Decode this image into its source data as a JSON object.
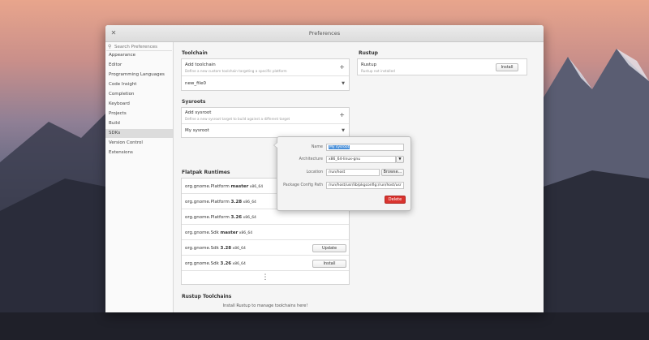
{
  "window": {
    "title": "Preferences"
  },
  "sidebar": {
    "search_placeholder": "Search Preferences",
    "items": [
      {
        "label": "Appearance"
      },
      {
        "label": "Editor"
      },
      {
        "label": "Programming Languages"
      },
      {
        "label": "Code Insight"
      },
      {
        "label": "Completion"
      },
      {
        "label": "Keyboard"
      },
      {
        "label": "Projects"
      },
      {
        "label": "Build"
      },
      {
        "label": "SDKs",
        "active": true
      },
      {
        "label": "Version Control"
      },
      {
        "label": "Extensions"
      }
    ]
  },
  "toolchain": {
    "title": "Toolchain",
    "add_title": "Add toolchain",
    "add_desc": "Define a new custom toolchain targeting a specific platform",
    "item": "new_file0"
  },
  "sysroots": {
    "title": "Sysroots",
    "add_title": "Add sysroot",
    "add_desc": "Define a new sysroot target to build against a different target",
    "item": "My sysroot"
  },
  "flatpak": {
    "title": "Flatpak Runtimes",
    "rows": [
      {
        "prefix": "org.gnome.Platform ",
        "bold": "master",
        "suffix": " x86_64",
        "button": ""
      },
      {
        "prefix": "org.gnome.Platform ",
        "bold": "3.28",
        "suffix": " x86_64",
        "button": ""
      },
      {
        "prefix": "org.gnome.Platform ",
        "bold": "3.26",
        "suffix": " x86_64",
        "button": ""
      },
      {
        "prefix": "org.gnome.Sdk ",
        "bold": "master",
        "suffix": " x86_64",
        "button": ""
      },
      {
        "prefix": "org.gnome.Sdk ",
        "bold": "3.28",
        "suffix": " x86_64",
        "button": "Update"
      },
      {
        "prefix": "org.gnome.Sdk ",
        "bold": "3.26",
        "suffix": " x86_64",
        "button": "Install"
      }
    ],
    "more": "⋮"
  },
  "rustup": {
    "title": "Rustup",
    "name": "Rustup",
    "status": "Rustup not installed",
    "install_label": "Install"
  },
  "rustup_toolchains": {
    "title": "Rustup Toolchains",
    "message": "Install Rustup to manage toolchains here!"
  },
  "popover": {
    "name_label": "Name",
    "name_value": "My sysroot",
    "arch_label": "Architecture",
    "arch_value": "x86_64-linux-gnu",
    "location_label": "Location",
    "location_value": "/run/host",
    "browse_label": "Browse...",
    "pkgconfig_label": "Package Config Path",
    "pkgconfig_value": "/run/host/usr/lib/pkgconfig:/run/host/usr",
    "delete_label": "Delete"
  }
}
